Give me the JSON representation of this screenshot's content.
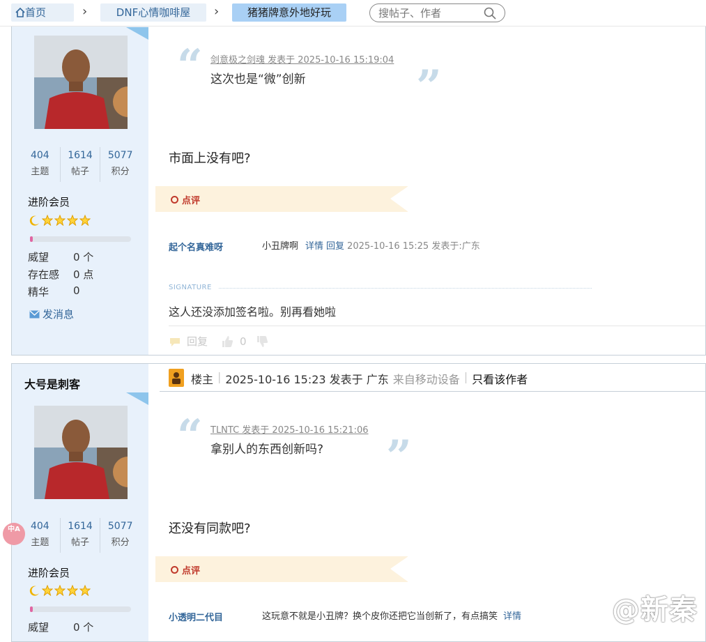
{
  "breadcrumb": {
    "home": "首页",
    "forum": "DNF心情咖啡屋",
    "thread": "猪猪牌意外地好玩"
  },
  "search": {
    "placeholder": "搜帖子、作者"
  },
  "posts": [
    {
      "author": "",
      "stats": {
        "topics": "404",
        "topics_label": "主题",
        "posts": "1614",
        "posts_label": "帖子",
        "points": "5077",
        "points_label": "积分"
      },
      "level": "进阶会员",
      "progress_fraction": 0.03,
      "attrs": [
        {
          "k": "威望",
          "v": "0 个"
        },
        {
          "k": "存在感",
          "v": "0 点"
        },
        {
          "k": "精华",
          "v": "0"
        }
      ],
      "message_link": "发消息",
      "quote": {
        "meta": "剑意极之剑魂 发表于 2025-10-16 15:19:04",
        "text": "这次也是“微”创新"
      },
      "body": "市面上没有吧?",
      "comment_label": "点评",
      "comment": {
        "user": "起个名真难呀",
        "text": "小丑牌啊",
        "detail": "详情",
        "reply": "回复",
        "time": "2025-10-16 15:25 发表于:广东"
      },
      "signature_label": "SIGNATURE",
      "signature": "这人还没添加签名啦。别再看她啦",
      "footer": {
        "reply": "回复",
        "likes": "0"
      }
    },
    {
      "author": "大号是刺客",
      "header": {
        "role": "楼主",
        "time": "2025-10-16 15:23 发表于 广东",
        "device": "来自移动设备",
        "only_author": "只看该作者"
      },
      "stats": {
        "topics": "404",
        "topics_label": "主题",
        "posts": "1614",
        "posts_label": "帖子",
        "points": "5077",
        "points_label": "积分"
      },
      "level": "进阶会员",
      "progress_fraction": 0.03,
      "attrs": [
        {
          "k": "威望",
          "v": "0 个"
        }
      ],
      "quote": {
        "meta": "TLNTC 发表于 2025-10-16 15:21:06",
        "text": "拿别人的东西创新吗?"
      },
      "body": "还没有同款吧?",
      "comment_label": "点评",
      "comment": {
        "user": "小透明二代目",
        "text": "这玩意不就是小丑牌？换个皮你还把它当创新了，有点搞笑",
        "detail": "详情"
      }
    }
  ],
  "translate_button": "中A",
  "watermark": "@新秦",
  "colors": {
    "link": "#336699",
    "sidebar": "#e8f1fb",
    "comment_band": "#fdf2dd",
    "active_crumb": "#a9d0f5"
  }
}
